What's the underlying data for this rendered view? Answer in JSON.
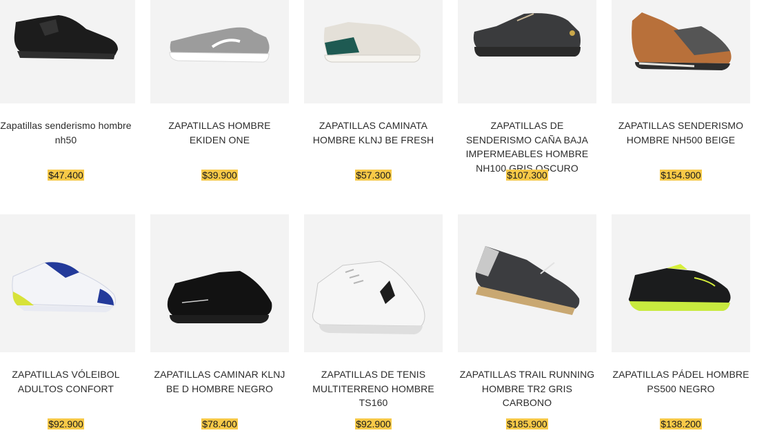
{
  "products": [
    {
      "title": "Zapatillas senderismo hombre nh50",
      "price": "$47.400",
      "icon": "shoe-hiking-black-icon"
    },
    {
      "title": "ZAPATILLAS HOMBRE EKIDEN ONE",
      "price": "$39.900",
      "icon": "shoe-running-grey-icon"
    },
    {
      "title": "ZAPATILLAS CAMINATA HOMBRE KLNJ BE FRESH",
      "price": "$57.300",
      "icon": "shoe-walking-beige-icon"
    },
    {
      "title": "ZAPATILLAS DE SENDERISMO CAÑA BAJA IMPERMEABLES HOMBRE NH100 GRIS OSCURO",
      "price": "$107.300",
      "icon": "shoe-hiking-dark-grey-icon"
    },
    {
      "title": "ZAPATILLAS SENDERISMO HOMBRE NH500 BEIGE",
      "price": "$154.900",
      "icon": "shoe-hiking-brown-icon"
    },
    {
      "title": "ZAPATILLAS VÓLEIBOL ADULTOS CONFORT",
      "price": "$92.900",
      "icon": "shoe-volleyball-white-icon"
    },
    {
      "title": "ZAPATILLAS CAMINAR KLNJ BE D HOMBRE NEGRO",
      "price": "$78.400",
      "icon": "shoe-walking-black-icon"
    },
    {
      "title": "ZAPATILLAS DE TENIS MULTITERRENO HOMBRE TS160",
      "price": "$92.900",
      "icon": "shoe-tennis-white-icon"
    },
    {
      "title": "ZAPATILLAS TRAIL RUNNING HOMBRE TR2 GRIS CARBONO",
      "price": "$185.900",
      "icon": "shoe-trail-grey-icon"
    },
    {
      "title": "ZAPATILLAS PÁDEL HOMBRE PS500 NEGRO",
      "price": "$138.200",
      "icon": "shoe-padel-black-icon"
    }
  ],
  "colors": {
    "price_highlight": "#f7c948",
    "thumb_bg": "#f3f3f3"
  }
}
